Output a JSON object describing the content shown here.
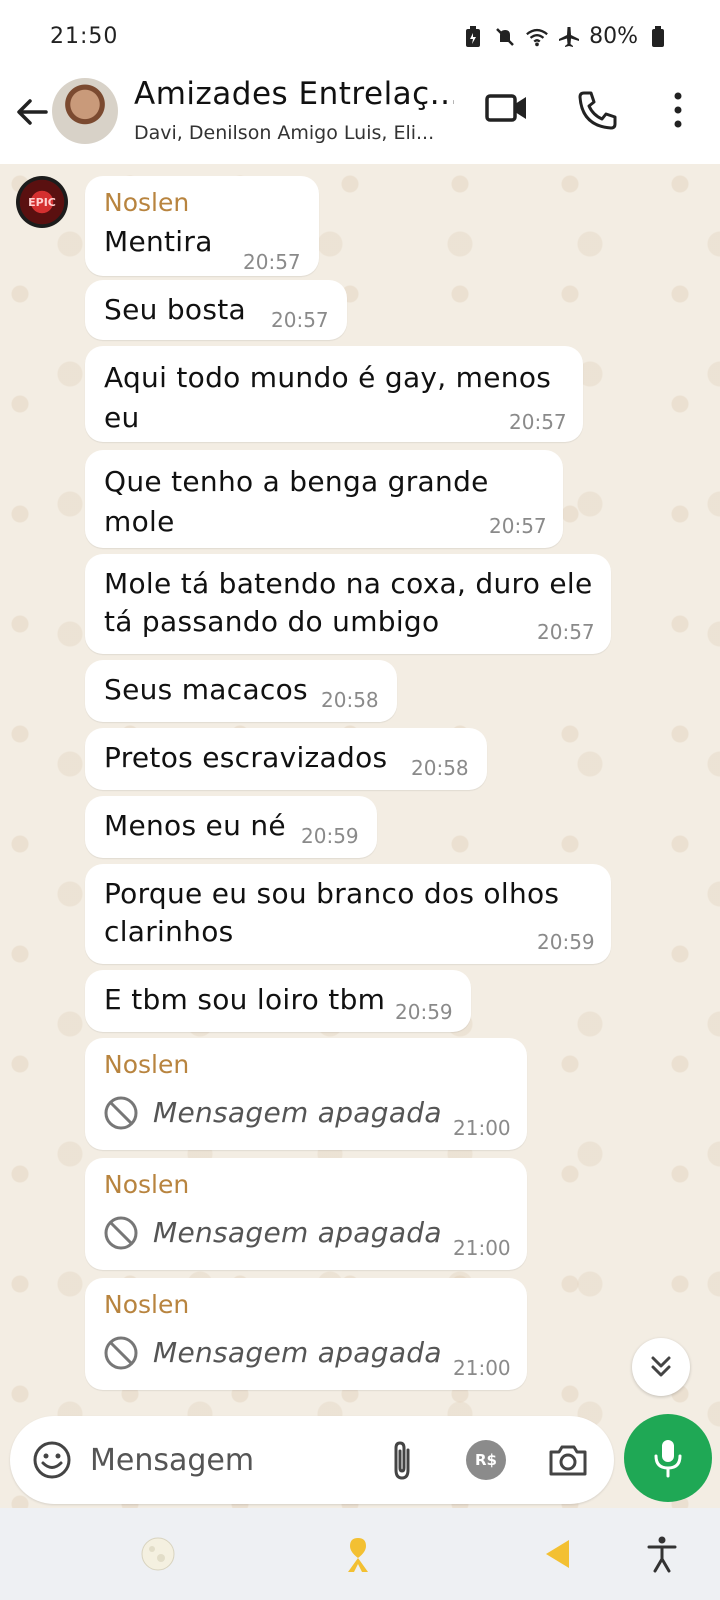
{
  "status_bar": {
    "time": "21:50",
    "battery": "80%",
    "icons": [
      "battery-saver-icon",
      "mute-icon",
      "wifi-icon",
      "airplane-icon",
      "battery-icon"
    ]
  },
  "header": {
    "title": "Amizades Entrelaç...",
    "members": "Davi, Denilson Amigo Luis, Eli...",
    "icons": [
      "back-arrow-icon",
      "video-call-icon",
      "phone-icon",
      "more-vert-icon"
    ]
  },
  "sender_avatar_text": "EPIC",
  "messages": [
    {
      "sender": "Noslen",
      "text": "Mentira",
      "time": "20:57"
    },
    {
      "text": "Seu bosta",
      "time": "20:57"
    },
    {
      "text": "Aqui todo mundo é gay, menos eu",
      "time": "20:57"
    },
    {
      "text": "Que tenho a benga grande mole",
      "time": "20:57"
    },
    {
      "text_line1": "Mole tá batendo na coxa, duro ele",
      "text_line2": "tá passando do umbigo",
      "time": "20:57"
    },
    {
      "text": "Seus macacos",
      "time": "20:58"
    },
    {
      "text": "Pretos escravizados",
      "time": "20:58"
    },
    {
      "text": "Menos eu né",
      "time": "20:59"
    },
    {
      "text_line1": "Porque eu sou branco dos olhos",
      "text_line2": "clarinhos",
      "time": "20:59"
    },
    {
      "text": "E tbm sou loiro tbm",
      "time": "20:59"
    },
    {
      "sender": "Noslen",
      "text": "Mensagem apagada",
      "time": "21:00",
      "deleted": true
    },
    {
      "sender": "Noslen",
      "text": "Mensagem apagada",
      "time": "21:00",
      "deleted": true
    },
    {
      "sender": "Noslen",
      "text": "Mensagem apagada",
      "time": "21:00",
      "deleted": true
    }
  ],
  "input": {
    "placeholder": "Mensagem",
    "payment_label": "R$"
  },
  "colors": {
    "chat_background": "#f3ede3",
    "sender_name": "#b8843f",
    "mic_button": "#1fa855"
  }
}
